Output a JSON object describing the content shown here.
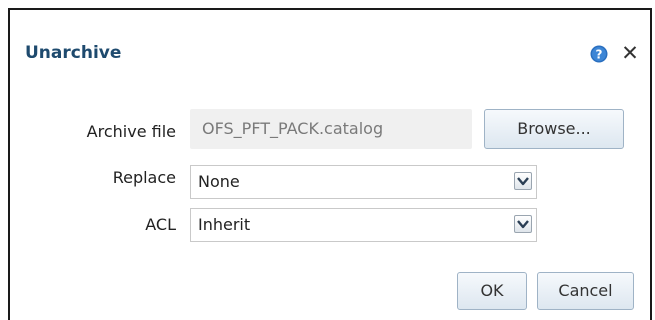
{
  "dialog": {
    "title": "Unarchive",
    "help_icon": "question-circle-icon",
    "close_glyph": "✕"
  },
  "form": {
    "archive_file": {
      "label": "Archive file",
      "value": "OFS_PFT_PACK.catalog",
      "browse_label": "Browse..."
    },
    "replace": {
      "label": "Replace",
      "selected": "None"
    },
    "acl": {
      "label": "ACL",
      "selected": "Inherit"
    }
  },
  "buttons": {
    "ok_label": "OK",
    "cancel_label": "Cancel"
  },
  "colors": {
    "title": "#1e4a6e",
    "help_icon": "#2a6fbf",
    "button_border": "#9fb3c6"
  }
}
